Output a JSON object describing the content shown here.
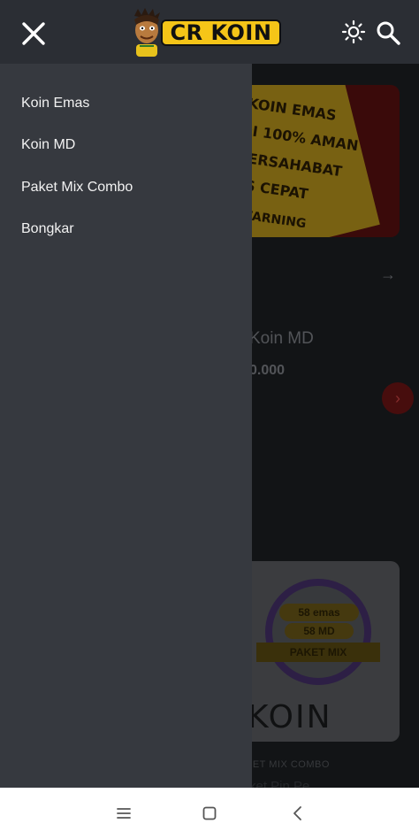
{
  "header": {
    "logo_text": "CR KOIN",
    "icons": {
      "close": "close-icon",
      "theme": "sun-icon",
      "search": "search-icon"
    }
  },
  "drawer": {
    "items": [
      {
        "label": "Koin Emas"
      },
      {
        "label": "Koin MD"
      },
      {
        "label": "Paket Mix Combo"
      },
      {
        "label": "Bongkar"
      }
    ]
  },
  "background_page": {
    "banner1_text": [
      "KOIN EMAS",
      "DI 100% AMAN",
      "BERSAHABAT",
      "ES CEPAT"
    ],
    "banner1_warning": "WARNING",
    "product": {
      "title": "Koin MD",
      "price": "0.000"
    },
    "banner2": {
      "line1": "58 emas",
      "line2": "58 MD",
      "line3": "PAKET MIX",
      "brand": "KOIN"
    },
    "category_label": "KET MIX COMBO",
    "category_sub": "ket Pin Pe"
  },
  "colors": {
    "appbar": "#2b2e34",
    "drawer": "#36393f",
    "logo_yellow": "#f5c518",
    "sysnav": "#ffffff"
  },
  "system_nav": {
    "icons": [
      "menu-icon",
      "home-icon",
      "back-icon"
    ]
  }
}
